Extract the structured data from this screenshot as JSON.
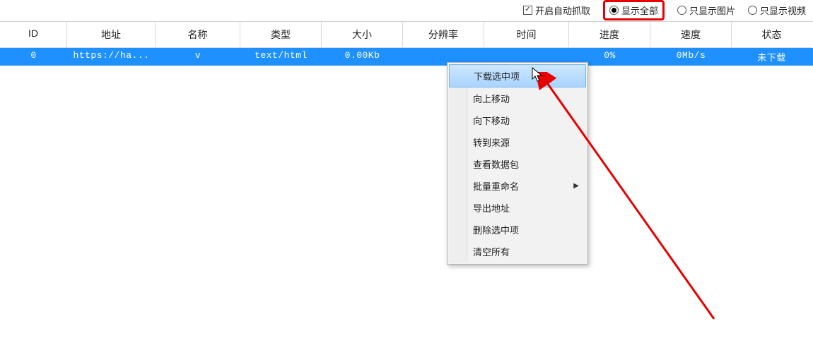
{
  "toolbar": {
    "auto_capture": {
      "label": "开启自动抓取",
      "checked": true
    },
    "filters": [
      {
        "label": "显示全部",
        "selected": true,
        "highlighted": true
      },
      {
        "label": "只显示图片",
        "selected": false,
        "highlighted": false
      },
      {
        "label": "只显示视频",
        "selected": false,
        "highlighted": false
      }
    ]
  },
  "table": {
    "headers": [
      "ID",
      "地址",
      "名称",
      "类型",
      "大小",
      "分辨率",
      "时间",
      "进度",
      "速度",
      "状态"
    ],
    "rows": [
      {
        "id": "0",
        "url": "https://ha...",
        "name": "v",
        "type": "text/html",
        "size": "0.00Kb",
        "resolution": "",
        "time": "",
        "progress": "0%",
        "speed": "0Mb/s",
        "status": "未下载"
      }
    ]
  },
  "context_menu": {
    "items": [
      {
        "label": "下载选中项",
        "highlighted": true,
        "has_submenu": false
      },
      {
        "label": "向上移动",
        "highlighted": false,
        "has_submenu": false
      },
      {
        "label": "向下移动",
        "highlighted": false,
        "has_submenu": false
      },
      {
        "label": "转到来源",
        "highlighted": false,
        "has_submenu": false
      },
      {
        "label": "查看数据包",
        "highlighted": false,
        "has_submenu": false
      },
      {
        "label": "批量重命名",
        "highlighted": false,
        "has_submenu": true
      },
      {
        "label": "导出地址",
        "highlighted": false,
        "has_submenu": false
      },
      {
        "label": "删除选中项",
        "highlighted": false,
        "has_submenu": false
      },
      {
        "label": "清空所有",
        "highlighted": false,
        "has_submenu": false
      }
    ]
  }
}
